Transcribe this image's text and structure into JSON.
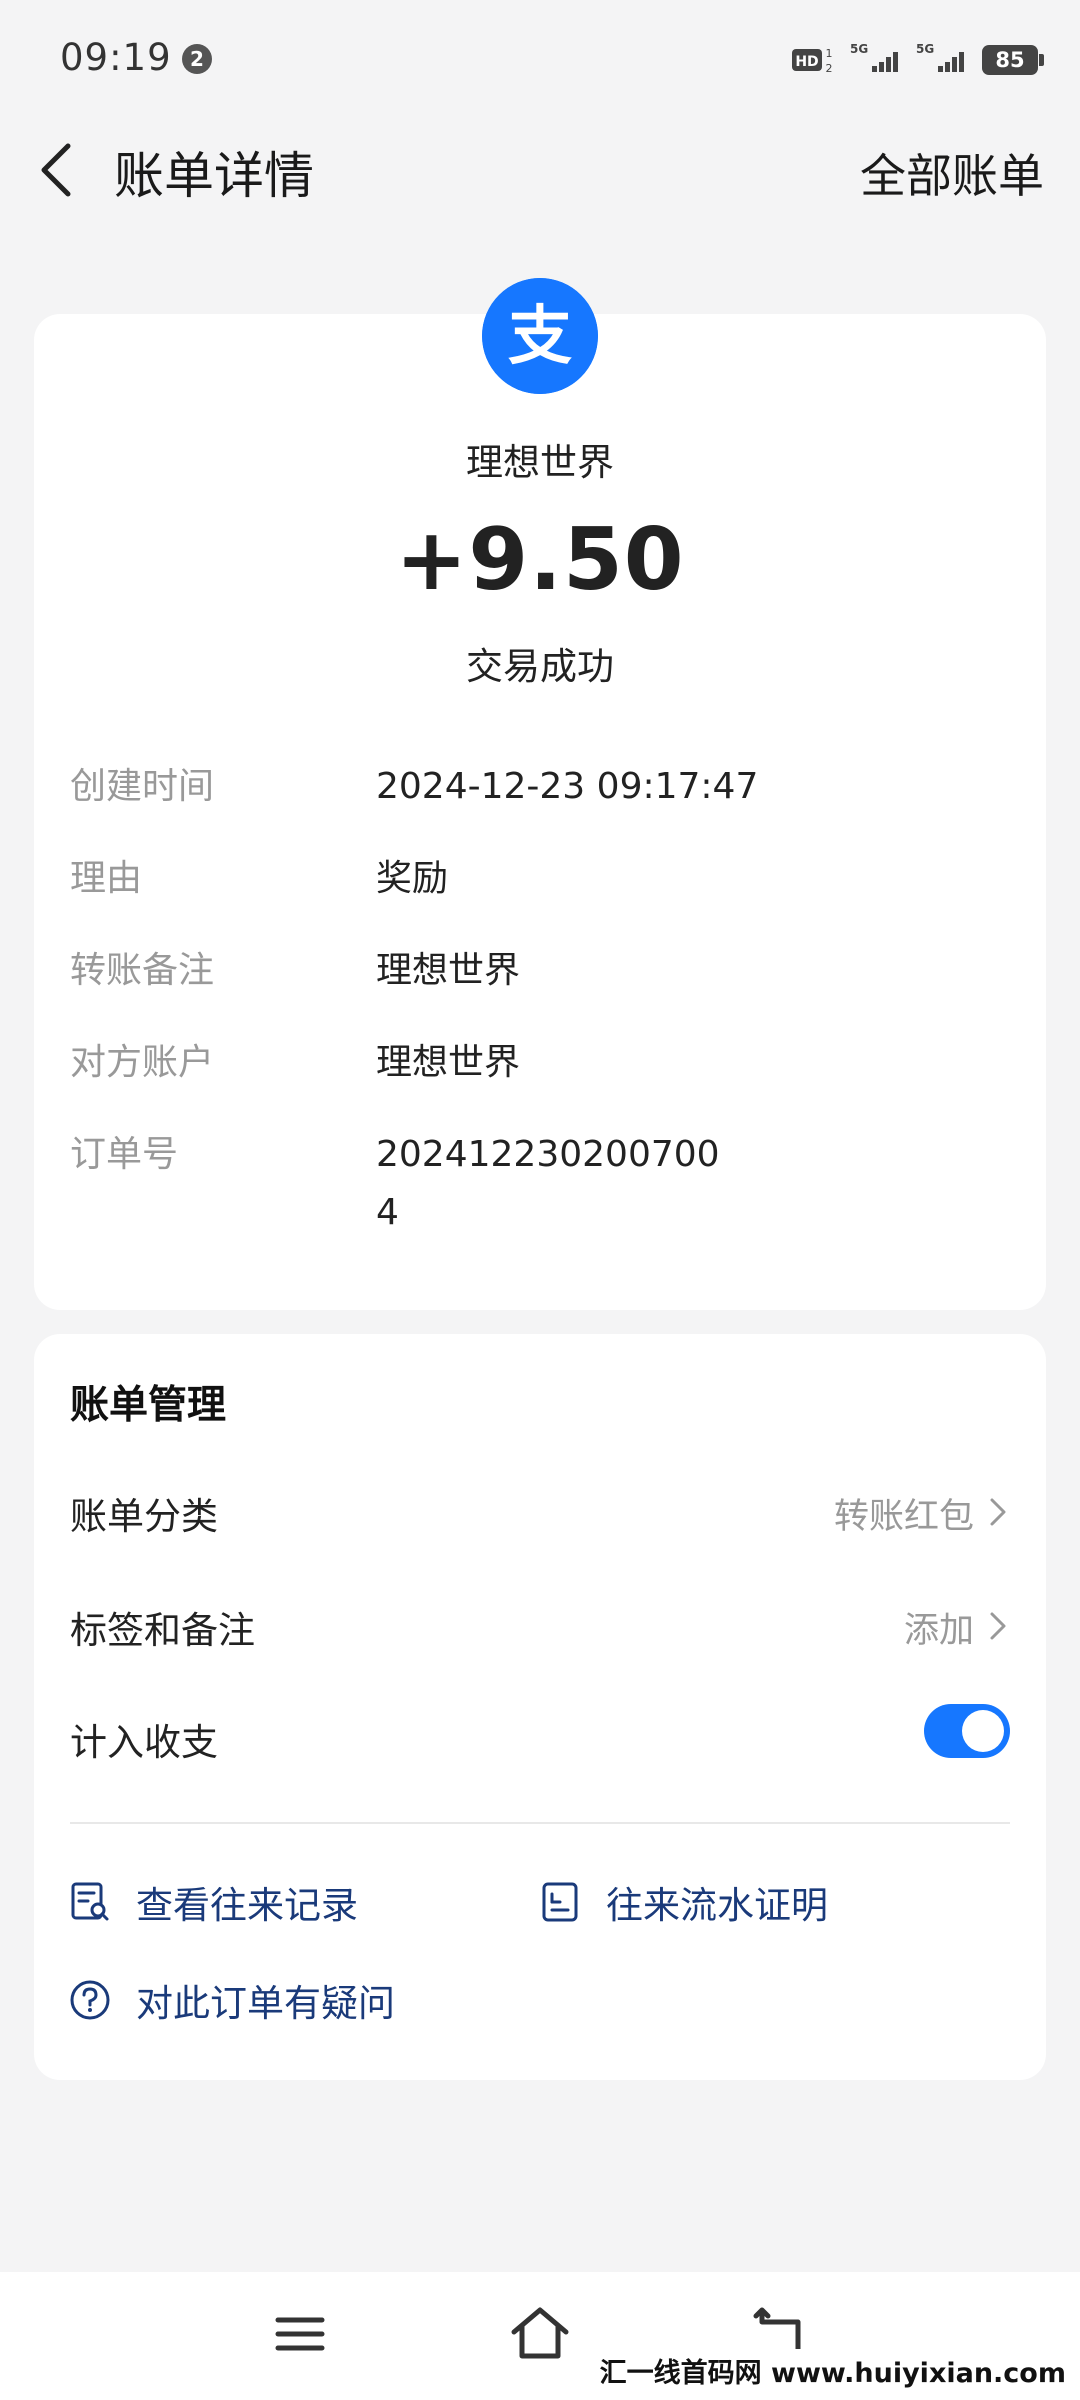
{
  "status_bar": {
    "time": "09:19",
    "notification_count": "2",
    "battery": "85"
  },
  "header": {
    "title": "账单详情",
    "right_action": "全部账单"
  },
  "bill": {
    "logo_icon": "alipay-logo-icon",
    "logo_char": "支",
    "merchant": "理想世界",
    "amount": "+9.50",
    "status": "交易成功",
    "details": [
      {
        "label": "创建时间",
        "value": "2024-12-23 09:17:47"
      },
      {
        "label": "理由",
        "value": "奖励"
      },
      {
        "label": "转账备注",
        "value": "理想世界"
      },
      {
        "label": "对方账户",
        "value": "理想世界"
      },
      {
        "label": "订单号",
        "value": "202412230200700"
      },
      {
        "label": "",
        "value": "4"
      }
    ]
  },
  "management": {
    "title": "账单管理",
    "rows": [
      {
        "label": "账单分类",
        "value": "转账红包"
      },
      {
        "label": "标签和备注",
        "value": "添加"
      },
      {
        "label": "计入收支",
        "toggle_on": true
      }
    ],
    "actions": [
      {
        "label": "查看往来记录",
        "icon": "record-search-icon"
      },
      {
        "label": "往来流水证明",
        "icon": "document-icon"
      },
      {
        "label": "对此订单有疑问",
        "icon": "question-icon"
      }
    ]
  },
  "watermark": "汇一线首码网 www.huiyixian.com",
  "colors": {
    "accent": "#1677ff",
    "background": "#f4f4f5",
    "link": "#1a3a7a",
    "secondary_text": "#999999"
  }
}
